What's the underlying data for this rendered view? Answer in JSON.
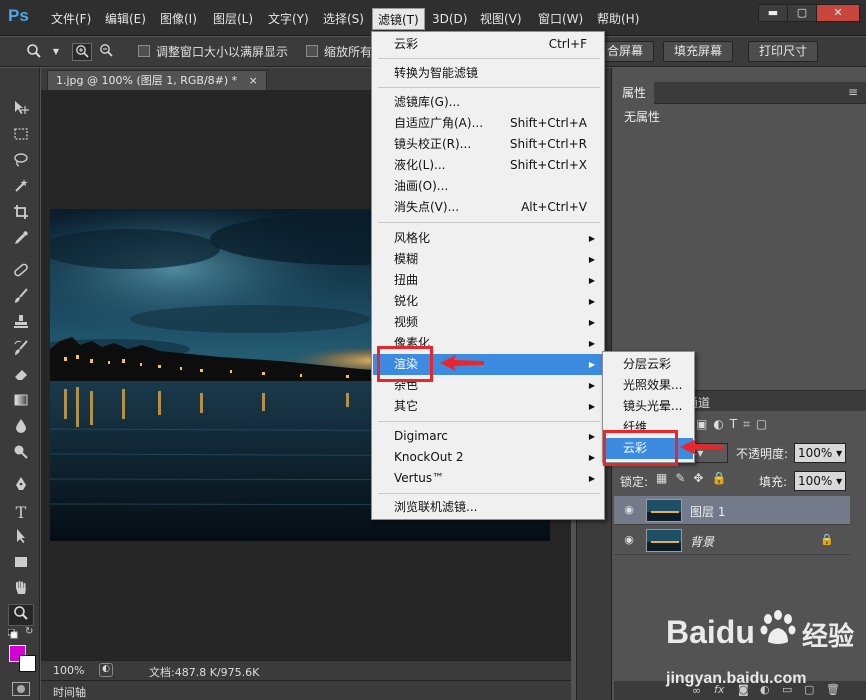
{
  "app": {
    "logo": "Ps"
  },
  "menubar": {
    "items": [
      "文件(F)",
      "编辑(E)",
      "图像(I)",
      "图层(L)",
      "文字(Y)",
      "选择(S)",
      "滤镜(T)",
      "3D(D)",
      "视图(V)",
      "窗口(W)",
      "帮助(H)"
    ],
    "active": "滤镜(T)"
  },
  "window_controls": {
    "minimize": "▬",
    "maximize": "▢",
    "close": "✕"
  },
  "options_bar": {
    "resize_windows_label": "调整窗口大小以满屏显示",
    "zoom_all_label": "缩放所有",
    "fit_screen_label": "合屏幕",
    "fill_screen_label": "填充屏幕",
    "print_size_label": "打印尺寸"
  },
  "document": {
    "tab_title": "1.jpg @ 100% (图层 1, RGB/8#) *",
    "tab_close": "×",
    "zoom": "100%",
    "doc_size": "文档:487.8 K/975.6K",
    "timeline": "时间轴"
  },
  "filter_menu": {
    "top": [
      {
        "label": "云彩",
        "shortcut": "Ctrl+F"
      }
    ],
    "smart": [
      {
        "label": "转换为智能滤镜"
      }
    ],
    "tools": [
      {
        "label": "滤镜库(G)..."
      },
      {
        "label": "自适应广角(A)...",
        "shortcut": "Shift+Ctrl+A"
      },
      {
        "label": "镜头校正(R)...",
        "shortcut": "Shift+Ctrl+R"
      },
      {
        "label": "液化(L)...",
        "shortcut": "Shift+Ctrl+X"
      },
      {
        "label": "油画(O)..."
      },
      {
        "label": "消失点(V)...",
        "shortcut": "Alt+Ctrl+V"
      }
    ],
    "categories": [
      "风格化",
      "模糊",
      "扭曲",
      "锐化",
      "视频",
      "像素化",
      "渲染",
      "杂色",
      "其它"
    ],
    "highlighted": "渲染",
    "plugins": [
      "Digimarc",
      "KnockOut 2",
      "Vertus™"
    ],
    "browse": "浏览联机滤镜..."
  },
  "render_submenu": {
    "items": [
      "分层云彩",
      "光照效果...",
      "镜头光晕...",
      "纤维",
      "云彩"
    ],
    "highlighted": "云彩"
  },
  "properties_panel": {
    "tab": "属性",
    "message": "无属性"
  },
  "layers_panel": {
    "channels_tab_partial": "通道",
    "opacity_label": "不透明度:",
    "opacity_value": "100%",
    "lock_label": "锁定:",
    "fill_label": "填充:",
    "fill_value": "100%",
    "layers": [
      {
        "name": "图层 1",
        "selected": true,
        "locked": false
      },
      {
        "name": "背景",
        "selected": false,
        "locked": true
      }
    ]
  },
  "watermark": {
    "brand": "Baidu",
    "product": "经验",
    "url": "jingyan.baidu.com"
  },
  "colors": {
    "foreground": "#d400d4",
    "background": "#ffffff",
    "menu_highlight": "#3c8be0",
    "annotation_red": "#e8262b"
  }
}
